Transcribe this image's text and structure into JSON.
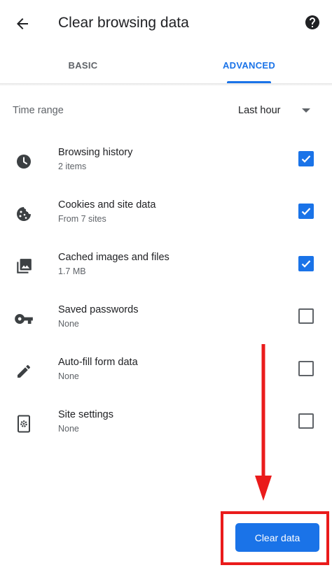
{
  "appbar": {
    "title": "Clear browsing data",
    "back_icon": "arrow-back-icon",
    "help_icon": "help-circle-icon"
  },
  "tabs": [
    {
      "label": "BASIC",
      "selected": false
    },
    {
      "label": "ADVANCED",
      "selected": true
    }
  ],
  "time_range": {
    "label": "Time range",
    "value": "Last hour"
  },
  "items": [
    {
      "icon": "clock-icon",
      "title": "Browsing history",
      "subtitle": "2 items",
      "checked": true
    },
    {
      "icon": "cookie-icon",
      "title": "Cookies and site data",
      "subtitle": "From 7 sites",
      "checked": true
    },
    {
      "icon": "image-icon",
      "title": "Cached images and files",
      "subtitle": "1.7 MB",
      "checked": true
    },
    {
      "icon": "key-icon",
      "title": "Saved passwords",
      "subtitle": "None",
      "checked": false
    },
    {
      "icon": "pencil-icon",
      "title": "Auto-fill form data",
      "subtitle": "None",
      "checked": false
    },
    {
      "icon": "site-settings-icon",
      "title": "Site settings",
      "subtitle": "None",
      "checked": false
    }
  ],
  "actions": {
    "clear_label": "Clear data"
  },
  "colors": {
    "accent": "#1a73e8",
    "annotation": "#ea1b1b",
    "text_primary": "#202124",
    "text_secondary": "#5f6368"
  }
}
